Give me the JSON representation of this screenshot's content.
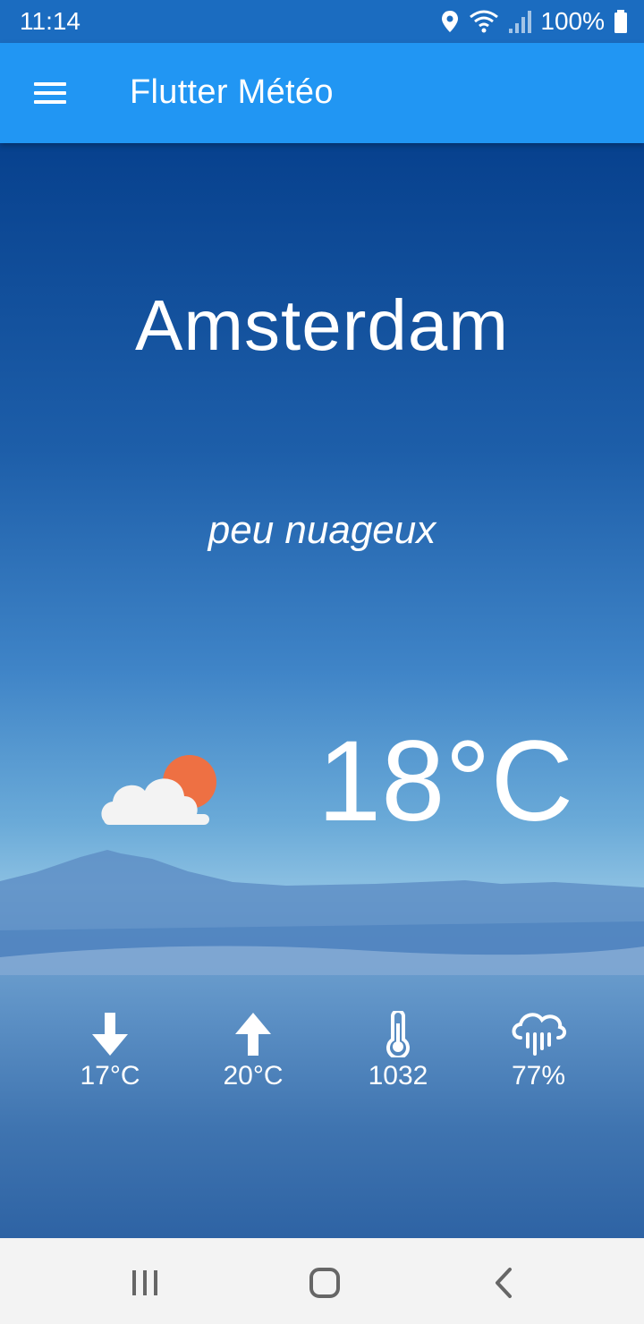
{
  "status_bar": {
    "time": "11:14",
    "battery": "100%"
  },
  "app_bar": {
    "title": "Flutter Météo",
    "menu_icon": "menu-icon"
  },
  "weather": {
    "city": "Amsterdam",
    "description": "peu nuageux",
    "temperature": "18°C",
    "condition_icon": "partly-cloudy-icon",
    "stats": [
      {
        "icon": "arrow-down-icon",
        "value": "17°C"
      },
      {
        "icon": "arrow-up-icon",
        "value": "20°C"
      },
      {
        "icon": "thermometer-icon",
        "value": "1032"
      },
      {
        "icon": "rain-cloud-icon",
        "value": "77%"
      }
    ]
  },
  "colors": {
    "app_bar": "#2196f3",
    "status_bar": "#1b6cc0",
    "sun": "#ee7043",
    "cloud": "#f3f3f3"
  }
}
